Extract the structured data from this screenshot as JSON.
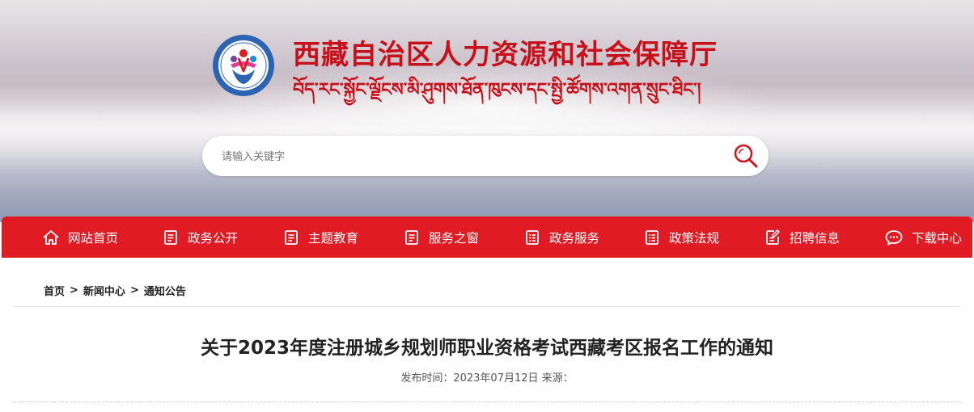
{
  "header": {
    "site_title": "西藏自治区人力资源和社会保障厅",
    "site_subtitle_tibetan": "བོད་རང་སྐྱོང་ལྗོངས་མི་ཤུགས་ཐོན་ཁུངས་དང་སྤྱི་ཚོགས་འགན་སྲུང་ཐིང་།",
    "emblem_icon": "hrss-emblem-icon"
  },
  "search": {
    "placeholder": "请输入关键字",
    "icon": "search-icon"
  },
  "nav": {
    "items": [
      {
        "label": "网站首页",
        "icon": "home-icon"
      },
      {
        "label": "政务公开",
        "icon": "document-icon"
      },
      {
        "label": "主题教育",
        "icon": "document-icon"
      },
      {
        "label": "服务之窗",
        "icon": "document-icon"
      },
      {
        "label": "政务服务",
        "icon": "checklist-icon"
      },
      {
        "label": "政策法规",
        "icon": "checklist-icon"
      },
      {
        "label": "招聘信息",
        "icon": "edit-document-icon"
      },
      {
        "label": "下载中心",
        "icon": "chat-icon"
      }
    ]
  },
  "breadcrumb": {
    "items": [
      "首页",
      "新闻中心",
      "通知公告"
    ],
    "separator": ">"
  },
  "article": {
    "title": "关于2023年度注册城乡规划师职业资格考试西藏考区报名工作的通知",
    "meta": "发布时间：2023年07月12日 来源："
  },
  "colors": {
    "accent_red": "#e01b24",
    "title_red": "#c8101a"
  }
}
